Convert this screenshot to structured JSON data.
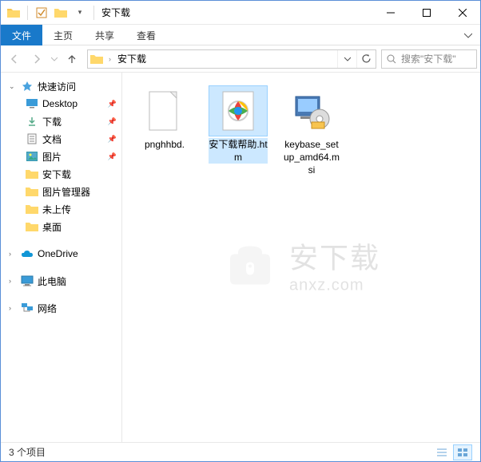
{
  "window": {
    "title": "安下载",
    "separator": "|"
  },
  "ribbon": {
    "tabs": [
      "文件",
      "主页",
      "共享",
      "查看"
    ],
    "active": 0
  },
  "nav": {
    "path_root": "安下载",
    "search_placeholder": "搜索\"安下载\""
  },
  "sidebar": {
    "quick_access": "快速访问",
    "items": [
      {
        "label": "Desktop",
        "icon": "desktop",
        "pinned": true
      },
      {
        "label": "下载",
        "icon": "downloads",
        "pinned": true
      },
      {
        "label": "文档",
        "icon": "documents",
        "pinned": true
      },
      {
        "label": "图片",
        "icon": "pictures",
        "pinned": true
      },
      {
        "label": "安下载",
        "icon": "folder",
        "pinned": false
      },
      {
        "label": "图片管理器",
        "icon": "folder",
        "pinned": false
      },
      {
        "label": "未上传",
        "icon": "folder",
        "pinned": false
      },
      {
        "label": "桌面",
        "icon": "folder",
        "pinned": false
      }
    ],
    "onedrive": "OneDrive",
    "this_pc": "此电脑",
    "network": "网络"
  },
  "files": [
    {
      "name": "pnghhbd.",
      "type": "file"
    },
    {
      "name": "安下载帮助.htm",
      "type": "htm",
      "selected": true
    },
    {
      "name": "keybase_setup_amd64.msi",
      "type": "msi"
    }
  ],
  "watermark": {
    "cn": "安下载",
    "en": "anxz.com"
  },
  "status": {
    "text": "3 个项目"
  }
}
